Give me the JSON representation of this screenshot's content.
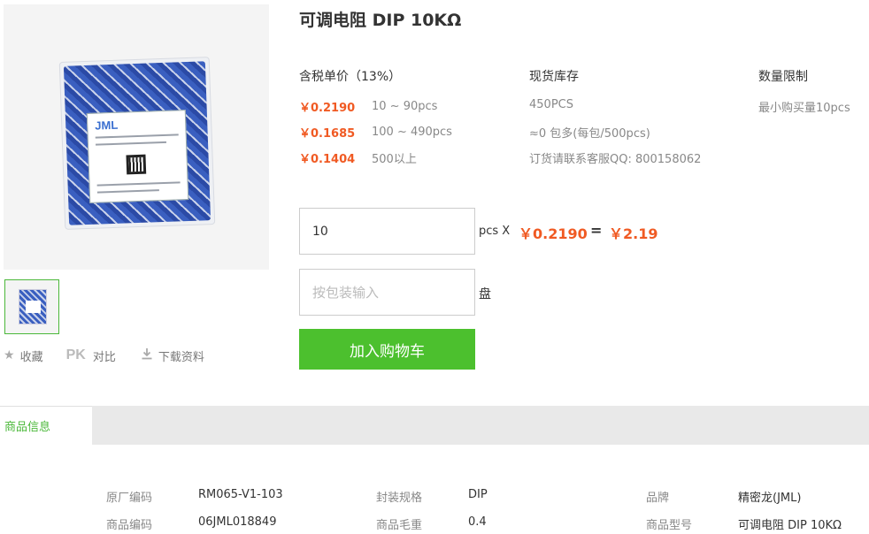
{
  "product": {
    "title": "可调电阻 DIP 10KΩ",
    "image_logo": "JML"
  },
  "actions": [
    {
      "icon": "star-icon",
      "label": "收藏"
    },
    {
      "icon": "pk",
      "icon_text": "PK",
      "label": "对比"
    },
    {
      "icon": "download-icon",
      "label": "下载资料"
    }
  ],
  "pricing": {
    "header": "含税单价（13%）",
    "tiers": [
      {
        "price": "￥0.2190",
        "range": "10 ~ 90pcs"
      },
      {
        "price": "￥0.1685",
        "range": "100 ~ 490pcs"
      },
      {
        "price": "￥0.1404",
        "range": "500以上"
      }
    ]
  },
  "stock": {
    "header": "现货库存",
    "lines": [
      "450PCS",
      "≈0 包多(每包/500pcs)",
      "订货请联系客服QQ: 800158062"
    ]
  },
  "limit": {
    "header": "数量限制",
    "lines": [
      "最小购买量10pcs"
    ]
  },
  "order": {
    "qty_value": "10",
    "pcs_x": "pcs X",
    "unit_price": "￥0.2190",
    "equals": "=",
    "total": "￥2.19",
    "pack_placeholder": "按包装输入",
    "pack_unit": "盘",
    "cart_button": "加入购物车"
  },
  "tabs": {
    "active": "商品信息"
  },
  "info": {
    "rows": [
      [
        {
          "label": "原厂编码",
          "value": "RM065-V1-103"
        },
        {
          "label": "封装规格",
          "value": "DIP"
        },
        {
          "label": "品牌",
          "value": "精密龙(JML)"
        }
      ],
      [
        {
          "label": "商品编码",
          "value": "06JML018849"
        },
        {
          "label": "商品毛重",
          "value": "0.4"
        },
        {
          "label": "商品型号",
          "value": "可调电阻 DIP 10KΩ"
        }
      ]
    ]
  },
  "colors": {
    "accent_green": "#4cc02e",
    "price_orange": "#f05a23"
  }
}
